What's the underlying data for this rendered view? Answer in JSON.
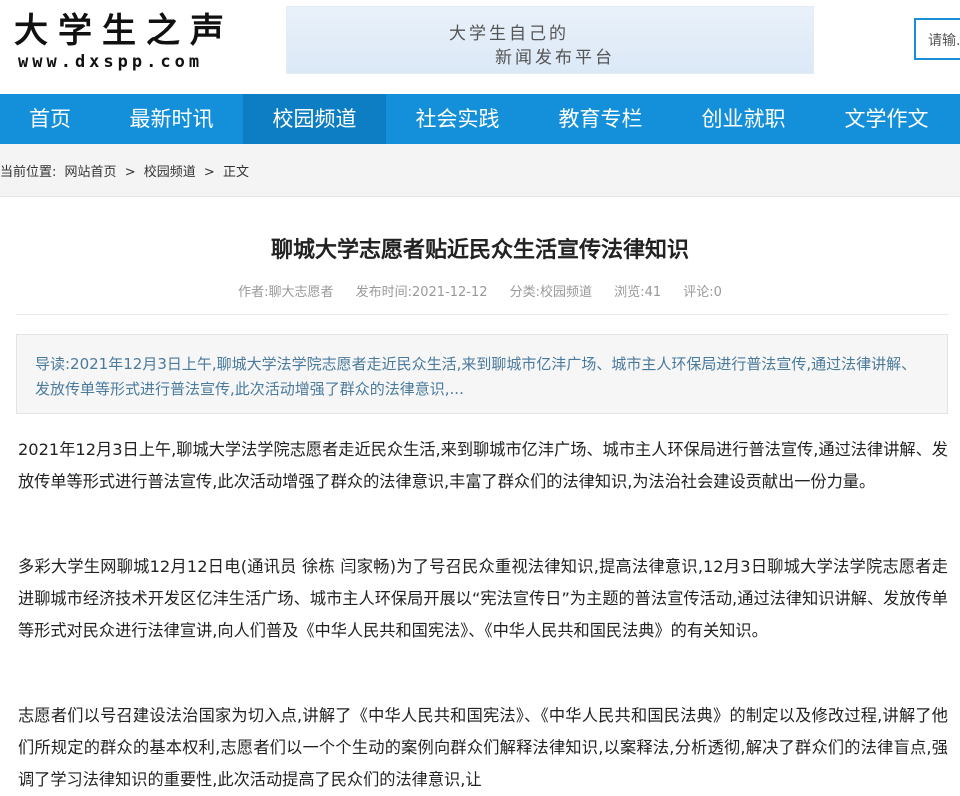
{
  "header": {
    "logo_title": "大学生之声",
    "logo_url": "www.dxspp.com",
    "banner_line1": "大学生自己的",
    "banner_line2": "新闻发布平台",
    "search_placeholder": "请输..."
  },
  "nav": {
    "items": [
      "首页",
      "最新时讯",
      "校园频道",
      "社会实践",
      "教育专栏",
      "创业就职",
      "文学作文"
    ],
    "active_index": 2
  },
  "breadcrumb": {
    "prefix": "当前位置:",
    "home": "网站首页",
    "sep1": ">",
    "channel": "校园频道",
    "sep2": ">",
    "current": "正文"
  },
  "article": {
    "title": "聊城大学志愿者贴近民众生活宣传法律知识",
    "meta": {
      "author": "作者:聊大志愿者",
      "date": "发布时间:2021-12-12",
      "category": "分类:校园频道",
      "views": "浏览:41",
      "comments": "评论:0"
    },
    "summary": "导读:2021年12月3日上午,聊城大学法学院志愿者走近民众生活,来到聊城市亿沣广场、城市主人环保局进行普法宣传,通过法律讲解、发放传单等形式进行普法宣传,此次活动增强了群众的法律意识,...",
    "paragraphs": [
      "2021年12月3日上午,聊城大学法学院志愿者走近民众生活,来到聊城市亿沣广场、城市主人环保局进行普法宣传,通过法律讲解、发放传单等形式进行普法宣传,此次活动增强了群众的法律意识,丰富了群众们的法律知识,为法治社会建设贡献出一份力量。",
      "多彩大学生网聊城12月12日电(通讯员 徐栋 闫家畅)为了号召民众重视法律知识,提高法律意识,12月3日聊城大学法学院志愿者走进聊城市经济技术开发区亿沣生活广场、城市主人环保局开展以“宪法宣传日”为主题的普法宣传活动,通过法律知识讲解、发放传单等形式对民众进行法律宣讲,向人们普及《中华人民共和国宪法》、《中华人民共和国民法典》的有关知识。",
      "志愿者们以号召建设法治国家为切入点,讲解了《中华人民共和国宪法》、《中华人民共和国民法典》的制定以及修改过程,讲解了他们所规定的群众的基本权利,志愿者们以一个个生动的案例向群众们解释法律知识,以案释法,分析透彻,解决了群众们的法律盲点,强调了学习法律知识的重要性,此次活动提高了民众们的法律意识,让"
    ]
  },
  "colors": {
    "nav_bg": "#1490db",
    "nav_active": "#0d7ec4",
    "summary_text": "#4a7a9c"
  }
}
